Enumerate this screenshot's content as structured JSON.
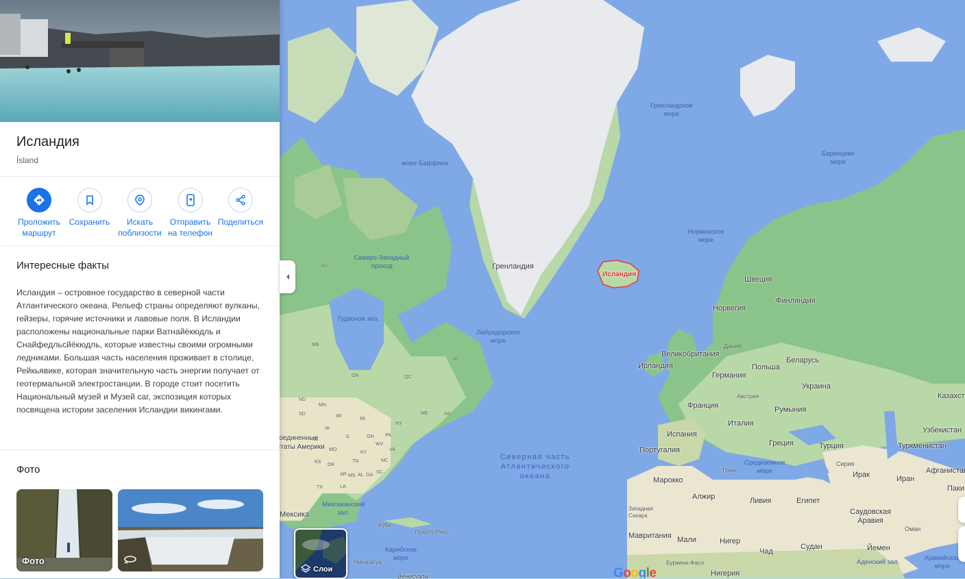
{
  "panel": {
    "title": "Исландия",
    "subtitle": "Ísland",
    "actions": [
      {
        "label": "Проложить маршрут",
        "icon": "directions-icon"
      },
      {
        "label": "Сохранить",
        "icon": "bookmark-icon"
      },
      {
        "label": "Искать поблизости",
        "icon": "nearby-icon"
      },
      {
        "label": "Отправить на телефон",
        "icon": "phone-icon"
      },
      {
        "label": "Поделиться",
        "icon": "share-icon"
      }
    ],
    "facts": {
      "title": "Интересные факты",
      "text": "Исландия – островное государство в северной части Атлантического океана. Рельеф страны определяют вулканы, гейзеры, горячие источники и лавовые поля. В Исландии расположены национальные парки Ватнайёкюдль и Снайфедльсйёкюдль, которые известны своими огромными ледниками. Большая часть населения проживает в столице, Рейкьявике, которая значительную часть энергии получает от геотермальной электростанции. В городе стоит посетить Национальный музей и Музей саг, экспозиция которых посвящена истории заселения Исландии викингами."
    },
    "photos": {
      "title": "Фото",
      "thumb1_label": "Фото"
    }
  },
  "map": {
    "layers_label": "Слои",
    "highlight": "Исландия",
    "countries": [
      "Гренландия",
      "Швеция",
      "Финляндия",
      "Норвегия",
      "Дания",
      "Великобритания",
      "Ирландия",
      "Беларусь",
      "Польша",
      "Германия",
      "Украина",
      "Австрия",
      "Франция",
      "Румыния",
      "Италия",
      "Испания",
      "Португалия",
      "Греция",
      "Турция",
      "Казахст",
      "Узбекистан",
      "Туркменистан",
      "Сирия",
      "Ирак",
      "Иран",
      "Афганистан",
      "Паки",
      "Тунис",
      "Марокко",
      "Алжир",
      "Ливия",
      "Египет",
      "Саудовская Аравия",
      "Оман",
      "Йемен",
      "Мавритания",
      "Мали",
      "Нигер",
      "Чад",
      "Судан",
      "Нигерия",
      "Мексика",
      "Куба",
      "Пуэрто-Рико",
      "Никарагуа",
      "Венесуэла",
      "Буркина-Фасо",
      "Западная Сахара",
      "Соединенные Штаты Америки"
    ],
    "seas": [
      "Гренландское море",
      "Баренцево море",
      "море Баффина",
      "Норвежское море",
      "Северо-Западный проход",
      "Гудзонов зал.",
      "Лабрадорское море",
      "Средиземное море",
      "Мексиканский зал.",
      "Карибское море",
      "Аденский зал.",
      "Аравийское море"
    ],
    "ocean": "Северная часть Атлантического океана",
    "states": [
      "NU",
      "MB",
      "ON",
      "QC",
      "NL",
      "ND",
      "SD",
      "MN",
      "WI",
      "MI",
      "NY",
      "ME",
      "NS",
      "IA",
      "IL",
      "OH",
      "PA",
      "NE",
      "KS",
      "MO",
      "KY",
      "WV",
      "VA",
      "OK",
      "AR",
      "TN",
      "NC",
      "SC",
      "MS",
      "AL",
      "GA",
      "TX",
      "LA"
    ],
    "logo": "Google"
  }
}
